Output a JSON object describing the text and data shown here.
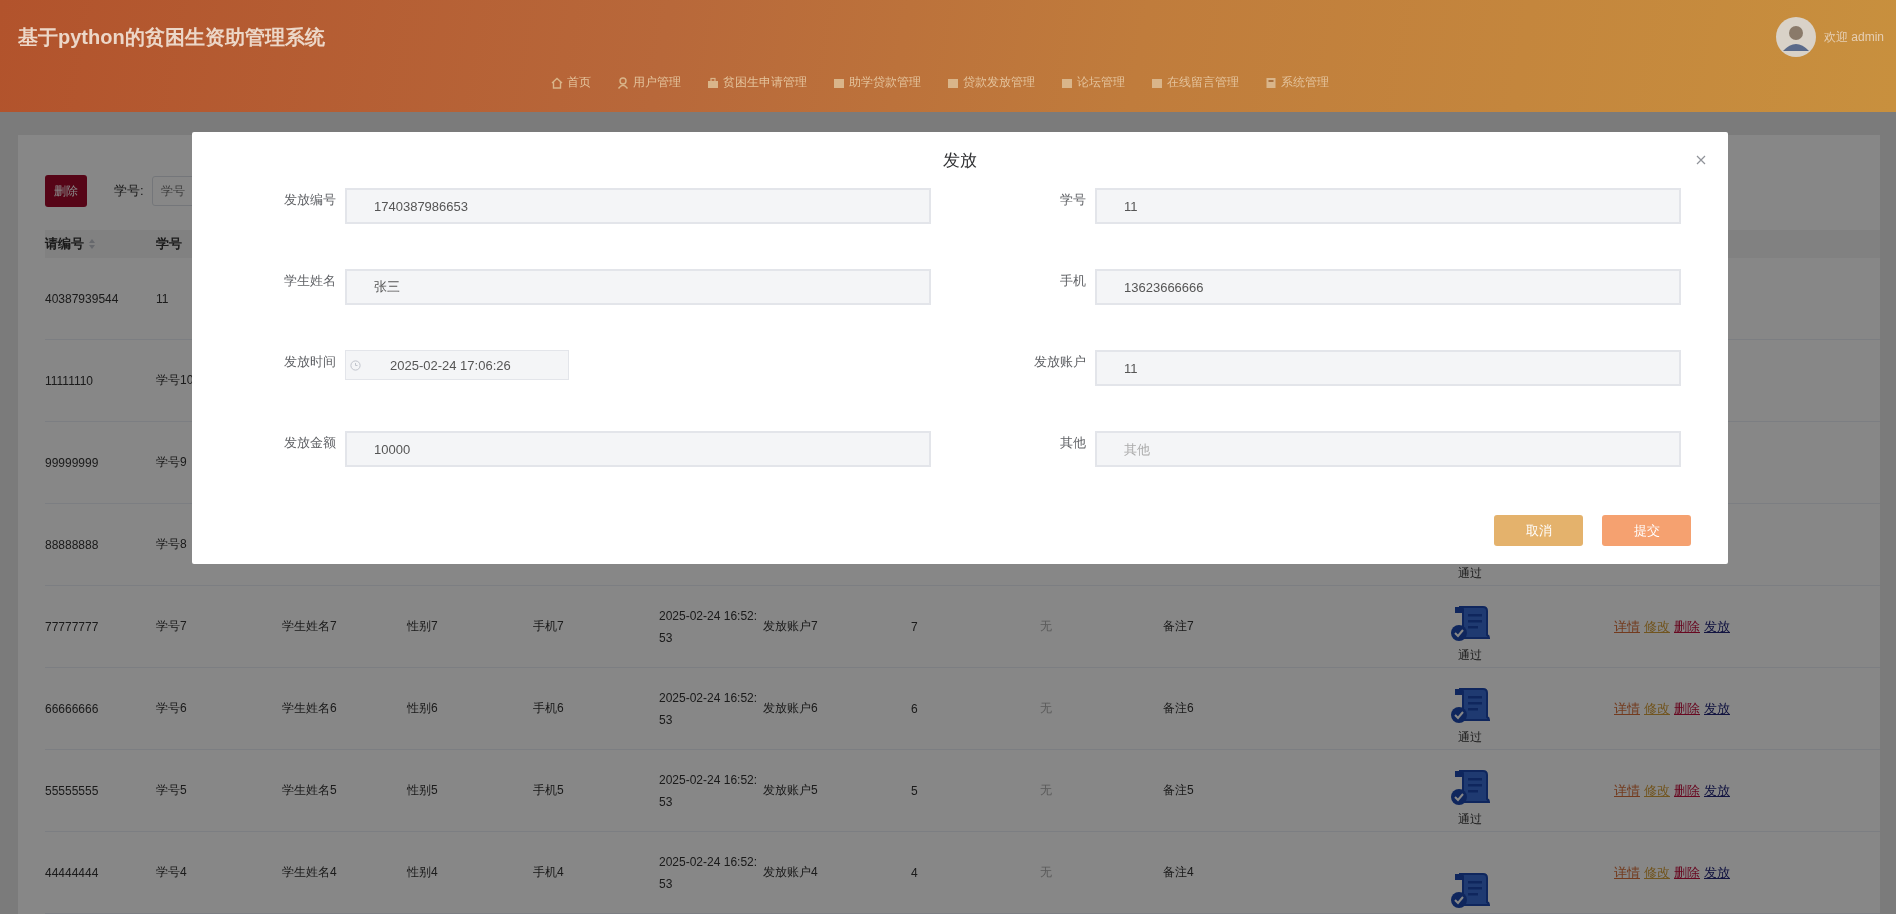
{
  "header": {
    "title": "基于python的贫困生资助管理系统",
    "user": "欢迎 admin",
    "nav": [
      {
        "label": "首页"
      },
      {
        "label": "用户管理"
      },
      {
        "label": "贫困生申请管理"
      },
      {
        "label": "助学贷款管理"
      },
      {
        "label": "贷款发放管理"
      },
      {
        "label": "论坛管理"
      },
      {
        "label": "在线留言管理"
      },
      {
        "label": "系统管理"
      }
    ]
  },
  "toolbar": {
    "delete_button": "删除",
    "search_label": "学号:",
    "search_placeholder": "学号"
  },
  "table": {
    "columns": [
      "请编号",
      "学号"
    ],
    "rows": [
      {
        "id": "40387939544",
        "student_no": "11"
      },
      {
        "id": "11111110",
        "student_no": "学号10"
      },
      {
        "id": "99999999",
        "student_no": "学号9"
      },
      {
        "id": "88888888",
        "student_no": "学号8",
        "status": "通过"
      },
      {
        "id": "77777777",
        "student_no": "学号7",
        "name": "学生姓名7",
        "gender": "性别7",
        "phone": "手机7",
        "time": "2025-02-24 16:52:53",
        "account": "发放账户7",
        "amount": "7",
        "other": "无",
        "remark": "备注7",
        "status_icon": true,
        "status": "通过",
        "actions": [
          {
            "label": "详情",
            "kind": "detail"
          },
          {
            "label": "修改",
            "kind": "edit"
          },
          {
            "label": "删除",
            "kind": "delete"
          },
          {
            "label": "发放",
            "kind": "issue"
          }
        ]
      },
      {
        "id": "66666666",
        "student_no": "学号6",
        "name": "学生姓名6",
        "gender": "性别6",
        "phone": "手机6",
        "time": "2025-02-24 16:52:53",
        "account": "发放账户6",
        "amount": "6",
        "other": "无",
        "remark": "备注6",
        "status_icon": true,
        "status": "通过",
        "actions": [
          {
            "label": "详情",
            "kind": "detail"
          },
          {
            "label": "修改",
            "kind": "edit"
          },
          {
            "label": "删除",
            "kind": "delete"
          },
          {
            "label": "发放",
            "kind": "issue"
          }
        ]
      },
      {
        "id": "55555555",
        "student_no": "学号5",
        "name": "学生姓名5",
        "gender": "性别5",
        "phone": "手机5",
        "time": "2025-02-24 16:52:53",
        "account": "发放账户5",
        "amount": "5",
        "other": "无",
        "remark": "备注5",
        "status_icon": true,
        "status": "通过",
        "actions": [
          {
            "label": "详情",
            "kind": "detail"
          },
          {
            "label": "修改",
            "kind": "edit"
          },
          {
            "label": "删除",
            "kind": "delete"
          },
          {
            "label": "发放",
            "kind": "issue"
          }
        ]
      },
      {
        "id": "44444444",
        "student_no": "学号4",
        "name": "学生姓名4",
        "gender": "性别4",
        "phone": "手机4",
        "time": "2025-02-24 16:52:53",
        "account": "发放账户4",
        "amount": "4",
        "other": "无",
        "remark": "备注4",
        "status_icon": true,
        "actions": [
          {
            "label": "详情",
            "kind": "detail"
          },
          {
            "label": "修改",
            "kind": "edit"
          },
          {
            "label": "删除",
            "kind": "delete"
          },
          {
            "label": "发放",
            "kind": "issue"
          }
        ]
      }
    ]
  },
  "dialog": {
    "title": "发放",
    "fields": [
      {
        "label": "发放编号",
        "value": "1740387986653",
        "kind": "text"
      },
      {
        "label": "学号",
        "value": "11",
        "kind": "text"
      },
      {
        "label": "学生姓名",
        "value": "张三",
        "kind": "text"
      },
      {
        "label": "手机",
        "value": "13623666666",
        "kind": "text"
      },
      {
        "label": "发放时间",
        "value": "2025-02-24 17:06:26",
        "kind": "datetime"
      },
      {
        "label": "发放账户",
        "value": "11",
        "kind": "text"
      },
      {
        "label": "发放金额",
        "value": "10000",
        "kind": "text"
      },
      {
        "label": "其他",
        "placeholder": "其他",
        "kind": "text"
      }
    ],
    "buttons": [
      {
        "label": "取消",
        "kind": "cancel"
      },
      {
        "label": "提交",
        "kind": "submit"
      }
    ]
  }
}
